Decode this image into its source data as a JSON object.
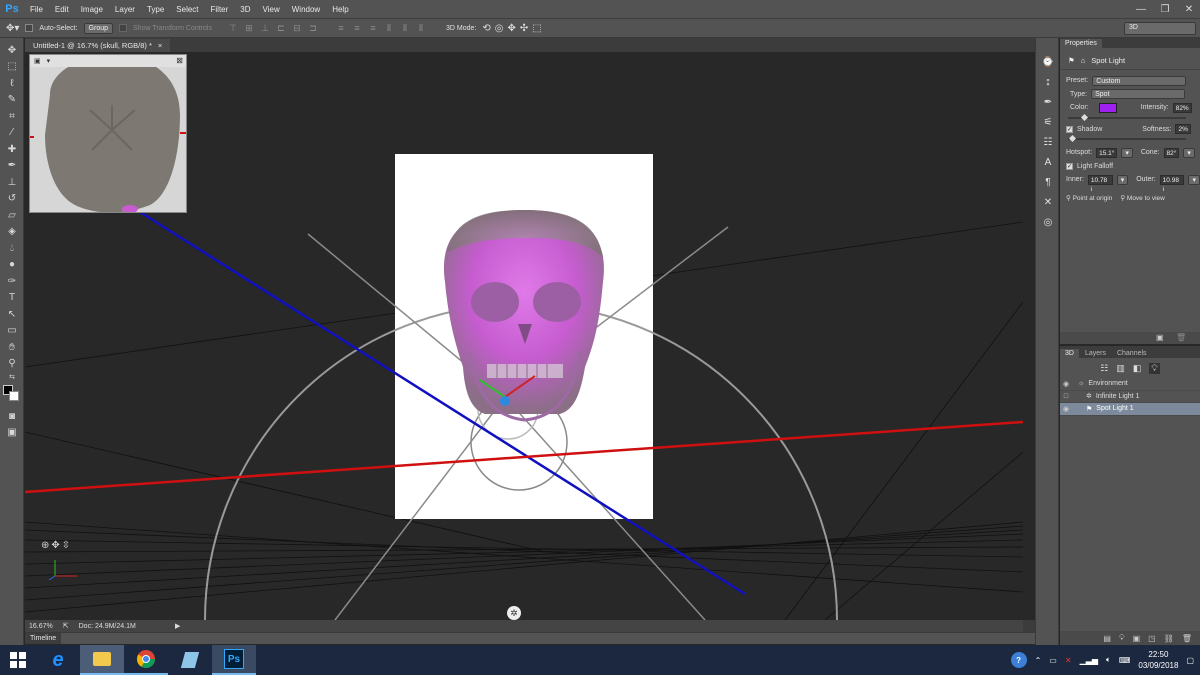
{
  "app": {
    "logo": "Ps"
  },
  "menubar": {
    "items": [
      "File",
      "Edit",
      "Image",
      "Layer",
      "Type",
      "Select",
      "Filter",
      "3D",
      "View",
      "Window",
      "Help"
    ]
  },
  "window_controls": {
    "minimize": "—",
    "restore": "❐",
    "close": "✕"
  },
  "optionsbar": {
    "auto_select_label": "Auto-Select:",
    "auto_select_value": "Group",
    "transform_controls_label": "Show Transform Controls",
    "mode_3d_label": "3D Mode:",
    "workspace": "3D"
  },
  "document": {
    "tab_title": "Untitled-1 @ 16.7% (skull, RGB/8) *",
    "close": "×",
    "zoom": "16.67%",
    "doc_info": "Doc: 24.9M/24.1M"
  },
  "timeline": {
    "label": "Timeline"
  },
  "properties": {
    "tab": "Properties",
    "header": "Spot Light",
    "preset_label": "Preset:",
    "preset_value": "Custom",
    "type_label": "Type:",
    "type_value": "Spot",
    "color_label": "Color:",
    "color_value": "#a020f0",
    "intensity_label": "Intensity:",
    "intensity_value": "82%",
    "intensity_fraction": 0.12,
    "shadow_label": "Shadow",
    "softness_label": "Softness:",
    "softness_value": "2%",
    "softness_fraction": 0.02,
    "hotspot_label": "Hotspot:",
    "hotspot_value": "15.1°",
    "cone_label": "Cone:",
    "cone_value": "82°",
    "falloff_label": "Light Falloff",
    "inner_label": "Inner:",
    "inner_value": "10.78 i",
    "outer_label": "Outer:",
    "outer_value": "10.98 i",
    "point_origin": "Point at origin",
    "move_to_view": "Move to view"
  },
  "panel3d": {
    "tabs": [
      "3D",
      "Layers",
      "Channels"
    ],
    "items": [
      {
        "label": "Environment"
      },
      {
        "label": "Infinite Light 1"
      },
      {
        "label": "Spot Light 1"
      }
    ]
  },
  "taskbar": {
    "time": "22:50",
    "date": "03/09/2018"
  }
}
